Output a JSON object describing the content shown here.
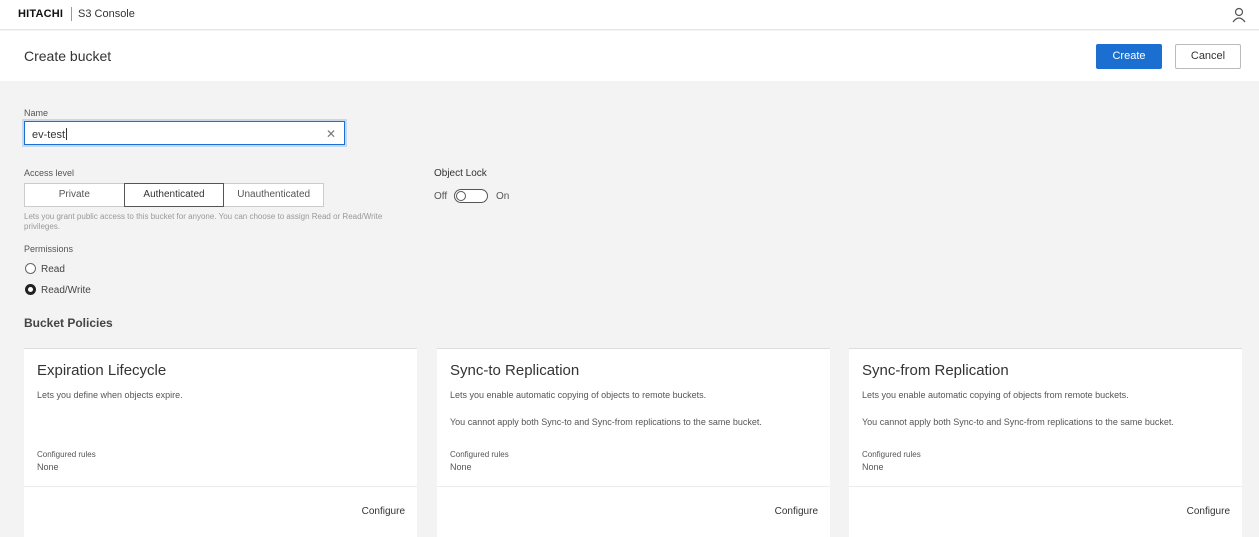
{
  "header": {
    "brand": "HITACHI",
    "app_name": "S3 Console",
    "user_icon": "user-icon"
  },
  "page": {
    "title": "Create bucket",
    "create_label": "Create",
    "cancel_label": "Cancel"
  },
  "form": {
    "name_label": "Name",
    "name_value": "ev-test",
    "access_label": "Access level",
    "access_options": [
      "Private",
      "Authenticated",
      "Unauthenticated"
    ],
    "access_selected": "Authenticated",
    "access_helper": "Lets you grant public access to this bucket for anyone. You can choose to assign Read or Read/Write privileges.",
    "permissions_label": "Permissions",
    "permissions": [
      {
        "label": "Read",
        "checked": false
      },
      {
        "label": "Read/Write",
        "checked": true
      }
    ],
    "object_lock_label": "Object Lock",
    "object_lock_off": "Off",
    "object_lock_on": "On",
    "object_lock_enabled": false
  },
  "policies": {
    "title": "Bucket Policies",
    "cards": [
      {
        "title": "Expiration Lifecycle",
        "desc": "Lets you define when objects expire.",
        "desc2": "",
        "rules_label": "Configured rules",
        "rules_value": "None",
        "action": "Configure"
      },
      {
        "title": "Sync-to Replication",
        "desc": "Lets you enable automatic copying of objects to remote buckets.",
        "desc2": "You cannot apply both Sync-to and Sync-from replications to the same bucket.",
        "rules_label": "Configured rules",
        "rules_value": "None",
        "action": "Configure"
      },
      {
        "title": "Sync-from Replication",
        "desc": "Lets you enable automatic copying of objects from remote buckets.",
        "desc2": "You cannot apply both Sync-to and Sync-from replications to the same bucket.",
        "rules_label": "Configured rules",
        "rules_value": "None",
        "action": "Configure"
      }
    ]
  },
  "colors": {
    "accent": "#1a6fd1",
    "background": "#f3f3f3"
  }
}
